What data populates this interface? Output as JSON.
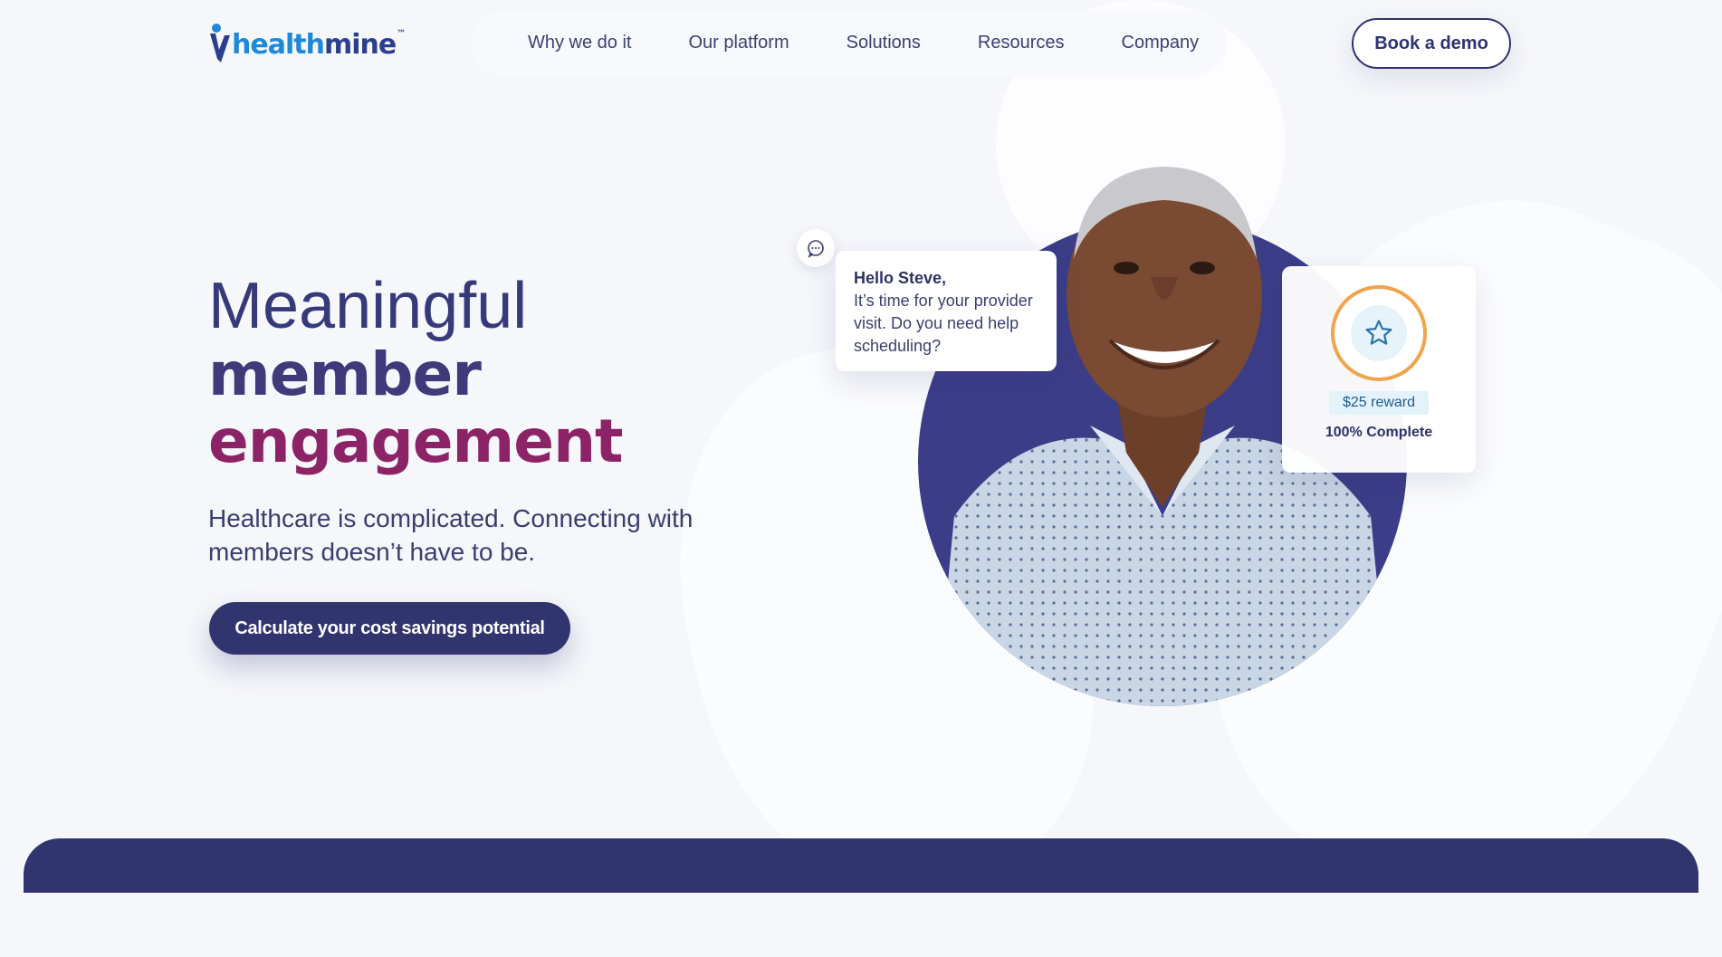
{
  "brand": {
    "logo_part1": "health",
    "logo_part2": "mine",
    "logo_tm": "™"
  },
  "nav": {
    "items": [
      {
        "label": "Why we do it"
      },
      {
        "label": "Our platform"
      },
      {
        "label": "Solutions"
      },
      {
        "label": "Resources"
      },
      {
        "label": "Company"
      }
    ],
    "cta_label": "Book a demo"
  },
  "hero": {
    "line1": "Meaningful",
    "line2": "member",
    "line3": "engagement",
    "subtitle": "Healthcare is complicated. Connecting with members doesn’t have to be.",
    "cta_label": "Calculate your cost savings potential"
  },
  "chat": {
    "greeting": "Hello Steve,",
    "message": "It’s time for your provider visit. Do you need help scheduling?",
    "icon": "chat-bubble-icon"
  },
  "reward": {
    "icon": "star-icon",
    "badge": "$25 reward",
    "status": "100% Complete",
    "progress": 1.0
  },
  "colors": {
    "navy": "#30346f",
    "magenta": "#8b2366",
    "logo_blue": "#1e88d9",
    "ring_orange": "#f0a54c"
  }
}
